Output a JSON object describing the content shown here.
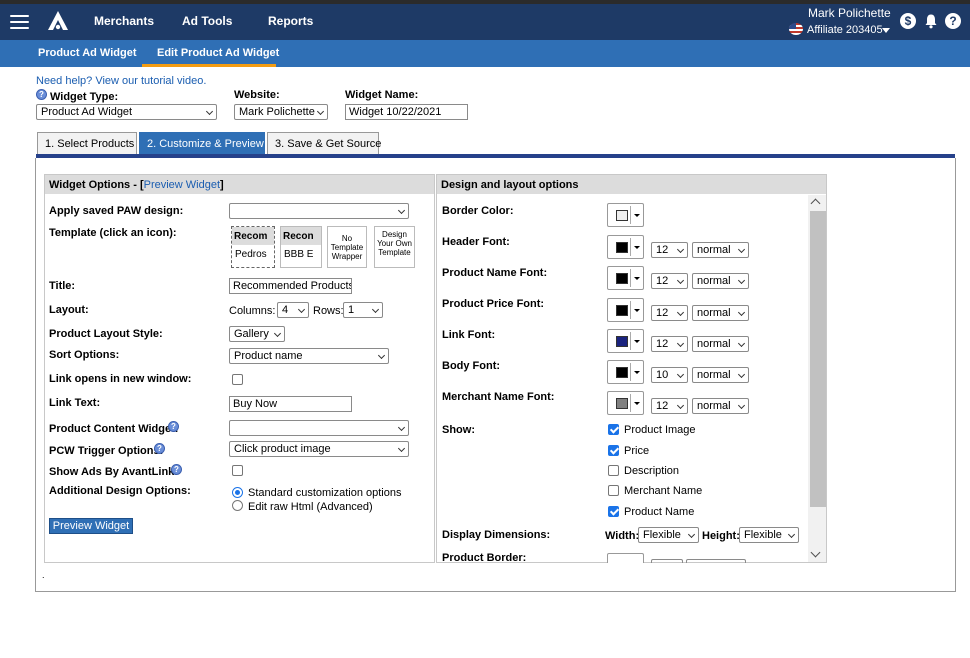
{
  "header": {
    "nav": [
      "Merchants",
      "Ad Tools",
      "Reports"
    ],
    "user_name": "Mark Polichette",
    "affiliate": "Affiliate 203405"
  },
  "subnav": [
    "Product Ad Widget",
    "Edit Product Ad Widget"
  ],
  "help_link": "Need help? View our tutorial video.",
  "top_fields": {
    "widget_type_label": "Widget Type:",
    "widget_type_value": "Product Ad Widget",
    "website_label": "Website:",
    "website_value": "Mark Polichette",
    "widget_name_label": "Widget Name:",
    "widget_name_value": "Widget 10/22/2021"
  },
  "tabs": [
    "1. Select Products",
    "2. Customize & Preview",
    "3. Save & Get Source"
  ],
  "left": {
    "head": "Widget Options - [",
    "head_link": "Preview Widget",
    "head_end": "]",
    "labels": {
      "apply_saved": "Apply saved PAW design:",
      "template": "Template (click an icon):",
      "title": "Title:",
      "layout": "Layout:",
      "layout_style": "Product Layout Style:",
      "sort": "Sort Options:",
      "link_new": "Link opens in new window:",
      "link_text": "Link Text:",
      "pcw": "Product Content Widget:",
      "pcw_trigger": "PCW Trigger Options:",
      "show_ads": "Show Ads By AvantLink:",
      "additional": "Additional Design Options:"
    },
    "templates": [
      {
        "head": "Recom",
        "body": "Pedros"
      },
      {
        "head": "Recon",
        "body": "BBB E"
      }
    ],
    "template_no_wrapper": "No Template Wrapper",
    "template_design_own": "Design Your Own Template",
    "apply_saved_value": "",
    "title_value": "Recommended Products",
    "columns_label": "Columns:",
    "columns_value": "4",
    "rows_label": "Rows:",
    "rows_value": "1",
    "layout_style_value": "Gallery",
    "sort_value": "Product name",
    "link_text_value": "Buy Now",
    "pcw_value": "",
    "pcw_trigger_value": "Click product image",
    "radio_standard": "Standard customization options",
    "radio_raw": "Edit raw Html (Advanced)",
    "preview_button": "Preview Widget"
  },
  "right": {
    "head": "Design and layout options",
    "border_color": "Border Color:",
    "fonts": [
      {
        "label": "Header Font:",
        "color": "#000000",
        "size": "12",
        "style": "normal"
      },
      {
        "label": "Product Name Font:",
        "color": "#000000",
        "size": "12",
        "style": "normal"
      },
      {
        "label": "Product Price Font:",
        "color": "#000000",
        "size": "12",
        "style": "normal"
      },
      {
        "label": "Link Font:",
        "color": "#1a237e",
        "size": "12",
        "style": "normal"
      },
      {
        "label": "Body Font:",
        "color": "#000000",
        "size": "10",
        "style": "normal"
      },
      {
        "label": "Merchant Name Font:",
        "color": "#808080",
        "size": "12",
        "style": "normal"
      }
    ],
    "border_color_value": "#eeeeee",
    "show_label": "Show:",
    "show_items": [
      {
        "label": "Product Image",
        "checked": true
      },
      {
        "label": "Price",
        "checked": true
      },
      {
        "label": "Description",
        "checked": false
      },
      {
        "label": "Merchant Name",
        "checked": false
      },
      {
        "label": "Product Name",
        "checked": true
      }
    ],
    "dims_label": "Display Dimensions:",
    "width_label": "Width:",
    "width_value": "Flexible",
    "height_label": "Height:",
    "height_value": "Flexible",
    "product_border": "Product Border:"
  }
}
